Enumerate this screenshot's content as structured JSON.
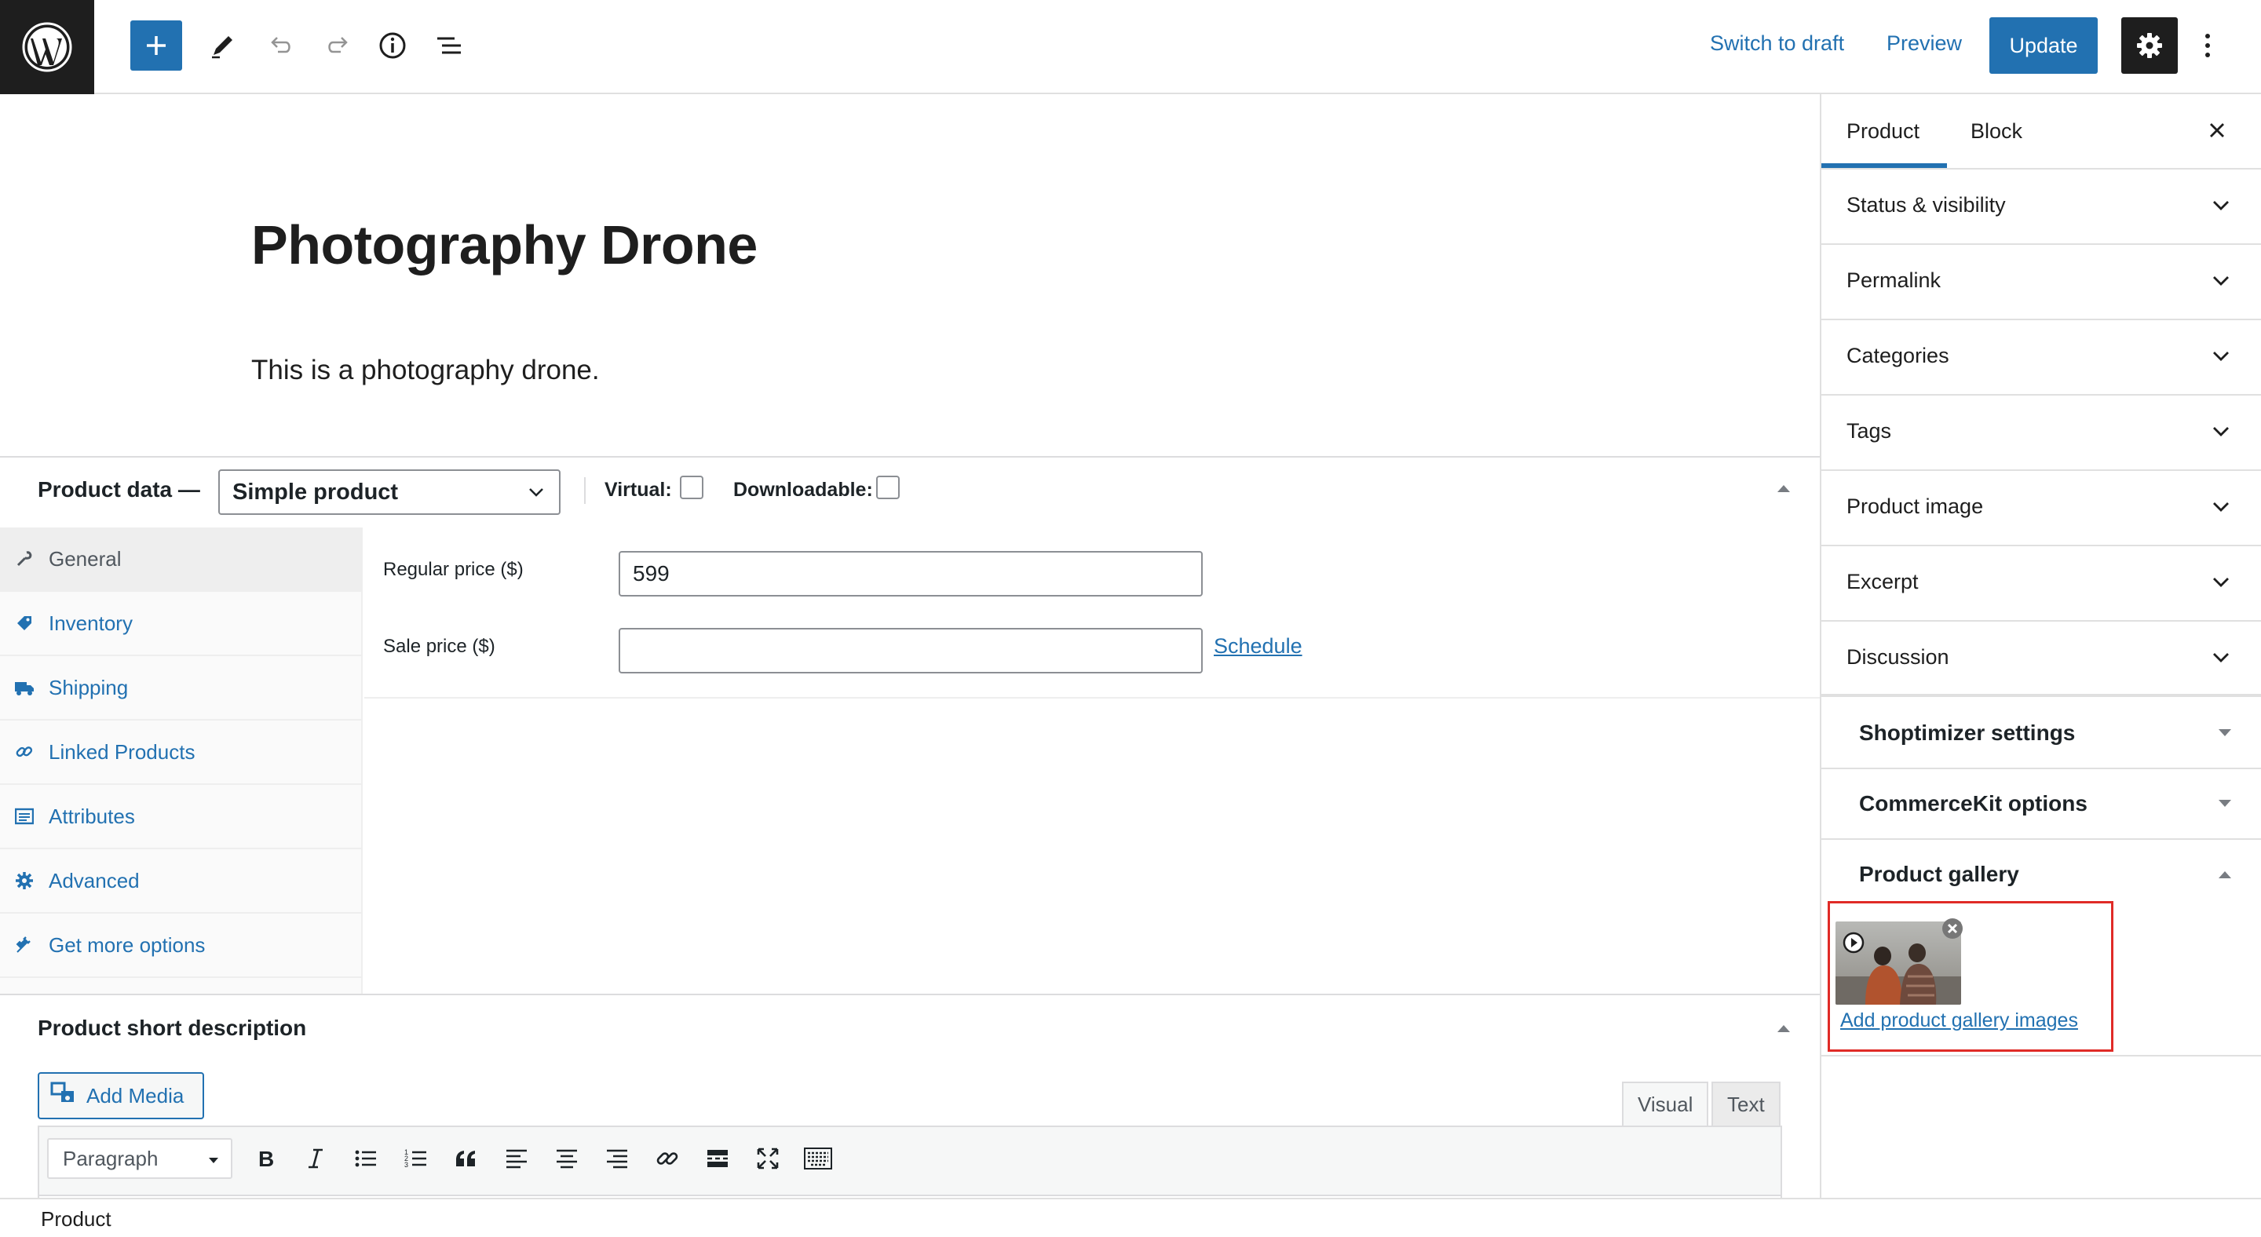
{
  "topbar": {
    "switch_to_draft": "Switch to draft",
    "preview": "Preview",
    "update": "Update"
  },
  "post": {
    "title": "Photography Drone",
    "paragraph": "This is a photography drone."
  },
  "product_data": {
    "label": "Product data —",
    "type_selected": "Simple product",
    "virtual_label": "Virtual:",
    "downloadable_label": "Downloadable:",
    "tabs": [
      {
        "label": "General",
        "icon": "wrench-icon"
      },
      {
        "label": "Inventory",
        "icon": "tag-icon"
      },
      {
        "label": "Shipping",
        "icon": "truck-icon"
      },
      {
        "label": "Linked Products",
        "icon": "link-icon"
      },
      {
        "label": "Attributes",
        "icon": "list-icon"
      },
      {
        "label": "Advanced",
        "icon": "gear-icon"
      },
      {
        "label": "Get more options",
        "icon": "plug-icon"
      }
    ],
    "regular_price_label": "Regular price ($)",
    "regular_price_value": "599",
    "sale_price_label": "Sale price ($)",
    "sale_price_value": "",
    "schedule_link": "Schedule"
  },
  "short_description": {
    "title": "Product short description",
    "add_media": "Add Media",
    "tab_visual": "Visual",
    "tab_text": "Text",
    "format_selected": "Paragraph"
  },
  "sidebar": {
    "tab_product": "Product",
    "tab_block": "Block",
    "panels": [
      "Status & visibility",
      "Permalink",
      "Categories",
      "Tags",
      "Product image",
      "Excerpt",
      "Discussion"
    ],
    "meta_boxes": [
      "Shoptimizer settings",
      "CommerceKit options",
      "Product gallery"
    ],
    "add_gallery_link": "Add product gallery images"
  },
  "footer": {
    "breadcrumb": "Product"
  },
  "colors": {
    "accent": "#2271b1",
    "dark": "#1e1e1e",
    "highlight": "#e02b27"
  }
}
